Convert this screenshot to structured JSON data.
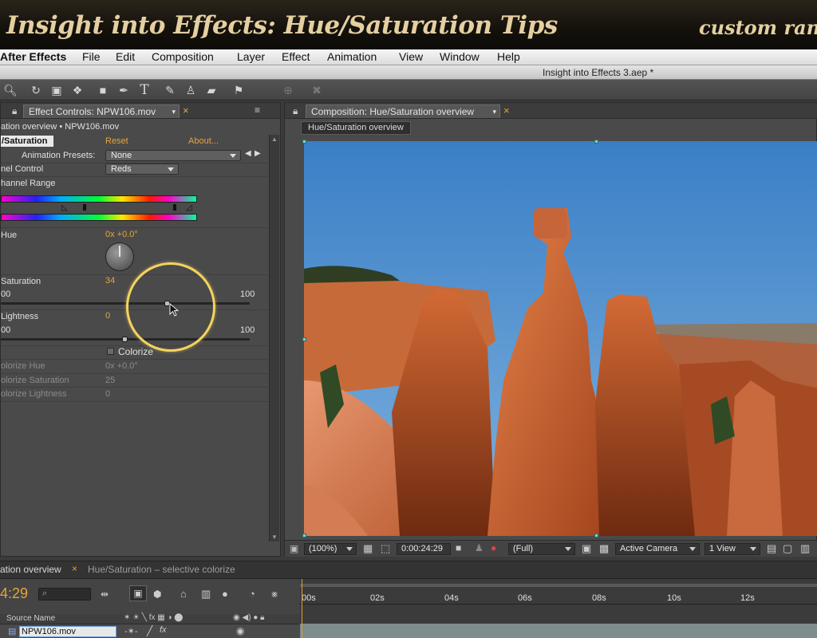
{
  "banner": {
    "title": "Insight into Effects: Hue/Saturation Tips",
    "right_text": "custom rang"
  },
  "menubar": {
    "app_name": "After Effects",
    "items": [
      "File",
      "Edit",
      "Composition",
      "Layer",
      "Effect",
      "Animation",
      "View",
      "Window",
      "Help"
    ]
  },
  "document_title": "Insight into Effects 3.aep *",
  "effect_controls": {
    "tab_label": "Effect Controls: NPW106.mov",
    "breadcrumb": "ation overview • NPW106.mov",
    "effect_name": "/Saturation",
    "reset_label": "Reset",
    "about_label": "About...",
    "animation_presets_label": "Animation Presets:",
    "animation_presets_value": "None",
    "channel_control_label": "nel Control",
    "channel_control_value": "Reds",
    "channel_range_label": "hannel Range",
    "hue_label": "Hue",
    "hue_value": "0x +0.0°",
    "saturation_label": "Saturation",
    "saturation_value": "34",
    "saturation_min": "00",
    "saturation_max": "100",
    "saturation_level": 0.67,
    "lightness_label": "Lightness",
    "lightness_value": "0",
    "lightness_min": "00",
    "lightness_max": "100",
    "lightness_level": 0.5,
    "colorize_label": "Colorize",
    "colorize_hue_label": "olorize Hue",
    "colorize_hue_value": "0x +0.0°",
    "colorize_saturation_label": "olorize Saturation",
    "colorize_saturation_value": "25",
    "colorize_lightness_label": "olorize Lightness",
    "colorize_lightness_value": "0"
  },
  "composition": {
    "tab_label": "Composition: Hue/Saturation overview",
    "crumb": "Hue/Saturation overview",
    "magnification": "(100%)",
    "timecode": "0:00:24:29",
    "resolution": "(Full)",
    "camera": "Active Camera",
    "views": "1 View"
  },
  "timeline": {
    "tab_active": "ation overview",
    "tab_other": "Hue/Saturation – selective colorize",
    "current_time": "4:29",
    "source_name_header": "Source Name",
    "layer_name": "NPW106.mov",
    "ruler_ticks": [
      "00s",
      "02s",
      "04s",
      "06s",
      "08s",
      "10s",
      "12s"
    ]
  },
  "colors": {
    "accent_orange": "#e6a43a",
    "highlight_ring": "#f4d35e"
  },
  "icons": [
    "zoom-icon",
    "rotate-icon",
    "camera-orbit-icon",
    "pan-icon",
    "rectangle-icon",
    "pen-icon",
    "text-icon",
    "brush-icon",
    "clone-stamp-icon",
    "eraser-icon",
    "puppet-pin-icon"
  ]
}
